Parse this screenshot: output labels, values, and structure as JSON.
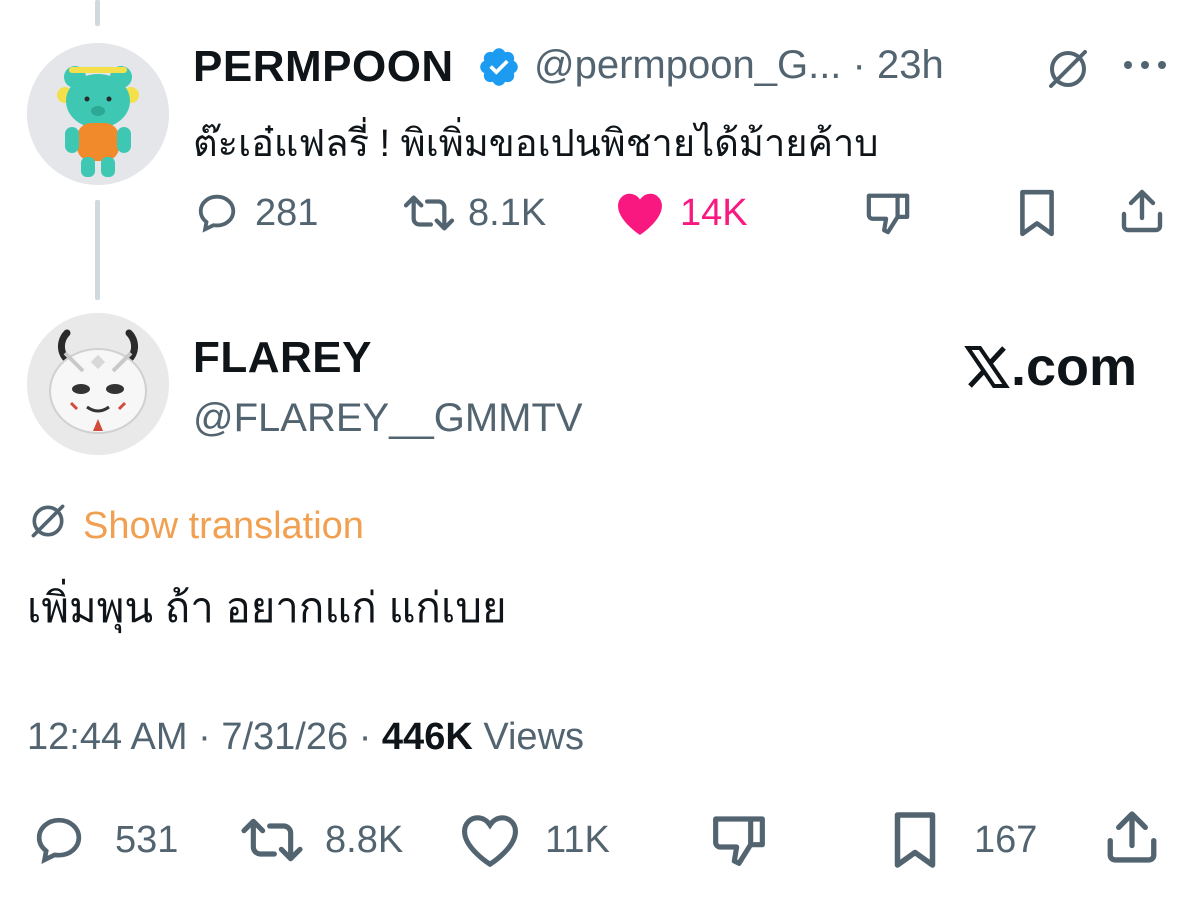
{
  "colors": {
    "verified": "#1d9bf0",
    "like_active": "#f91880",
    "translation_link": "#f0a050",
    "muted": "#536471"
  },
  "parent_tweet": {
    "author_name": "PERMPOON",
    "handle": "@permpoon_G...",
    "separator": "·",
    "time_ago": "23h",
    "text": "ต๊ะเอ๋แฟลรี่ ! พิเพิ่มขอเปนพิชายได้ม้ายค้าบ",
    "replies": "281",
    "reposts": "8.1K",
    "likes": "14K",
    "icons": [
      "grok-icon",
      "more-icon",
      "reply-icon",
      "repost-icon",
      "heart-filled-icon",
      "dislike-icon",
      "bookmark-icon",
      "share-icon"
    ]
  },
  "main_tweet": {
    "author_name": "FLAREY",
    "handle": "@FLAREY__GMMTV",
    "watermark": ".com",
    "translation_label": "Show translation",
    "text": "เพิ่มพุน ถ้า อยากแก่ แก่เบย",
    "time": "12:44 AM",
    "sep1": "·",
    "date": "7/31/26",
    "sep2": "·",
    "views_count": "446K",
    "views_label": "Views",
    "replies": "531",
    "reposts": "8.8K",
    "likes": "11K",
    "bookmarks": "167",
    "icons": [
      "x-logo-icon",
      "translate-icon",
      "reply-icon",
      "repost-icon",
      "heart-icon",
      "dislike-icon",
      "bookmark-icon",
      "share-icon"
    ]
  }
}
